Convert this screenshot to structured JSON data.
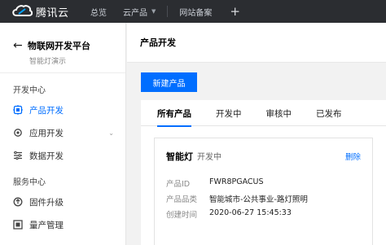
{
  "topbar": {
    "brand": "腾讯云",
    "nav": [
      "总览",
      "云产品",
      "网站备案"
    ],
    "plus": "+"
  },
  "sidebar": {
    "back_icon": "arrow-left-icon",
    "platform_title": "物联网开发平台",
    "platform_sub": "智能灯演示",
    "sections": [
      {
        "title": "开发中心",
        "items": [
          {
            "label": "产品开发",
            "icon": "product-icon",
            "active": true
          },
          {
            "label": "应用开发",
            "icon": "app-gear-icon",
            "has_caret": true
          },
          {
            "label": "数据开发",
            "icon": "data-icon"
          }
        ]
      },
      {
        "title": "服务中心",
        "items": [
          {
            "label": "固件升级",
            "icon": "firmware-icon"
          },
          {
            "label": "量产管理",
            "icon": "production-icon"
          }
        ]
      }
    ]
  },
  "main": {
    "page_title": "产品开发",
    "new_button": "新建产品",
    "tabs": [
      "所有产品",
      "开发中",
      "审核中",
      "已发布"
    ],
    "card": {
      "name": "智能灯",
      "status": "开发中",
      "delete": "删除",
      "rows": [
        {
          "label": "产品ID",
          "value": "FWR8PGACUS"
        },
        {
          "label": "产品品类",
          "value": "智能城市-公共事业-路灯照明"
        },
        {
          "label": "创建时间",
          "value": "2020-06-27 15:45:33"
        }
      ]
    }
  },
  "colors": {
    "accent": "#006eff",
    "topbar_bg": "#2b2d31",
    "logo_blue": "#00a3ff"
  }
}
